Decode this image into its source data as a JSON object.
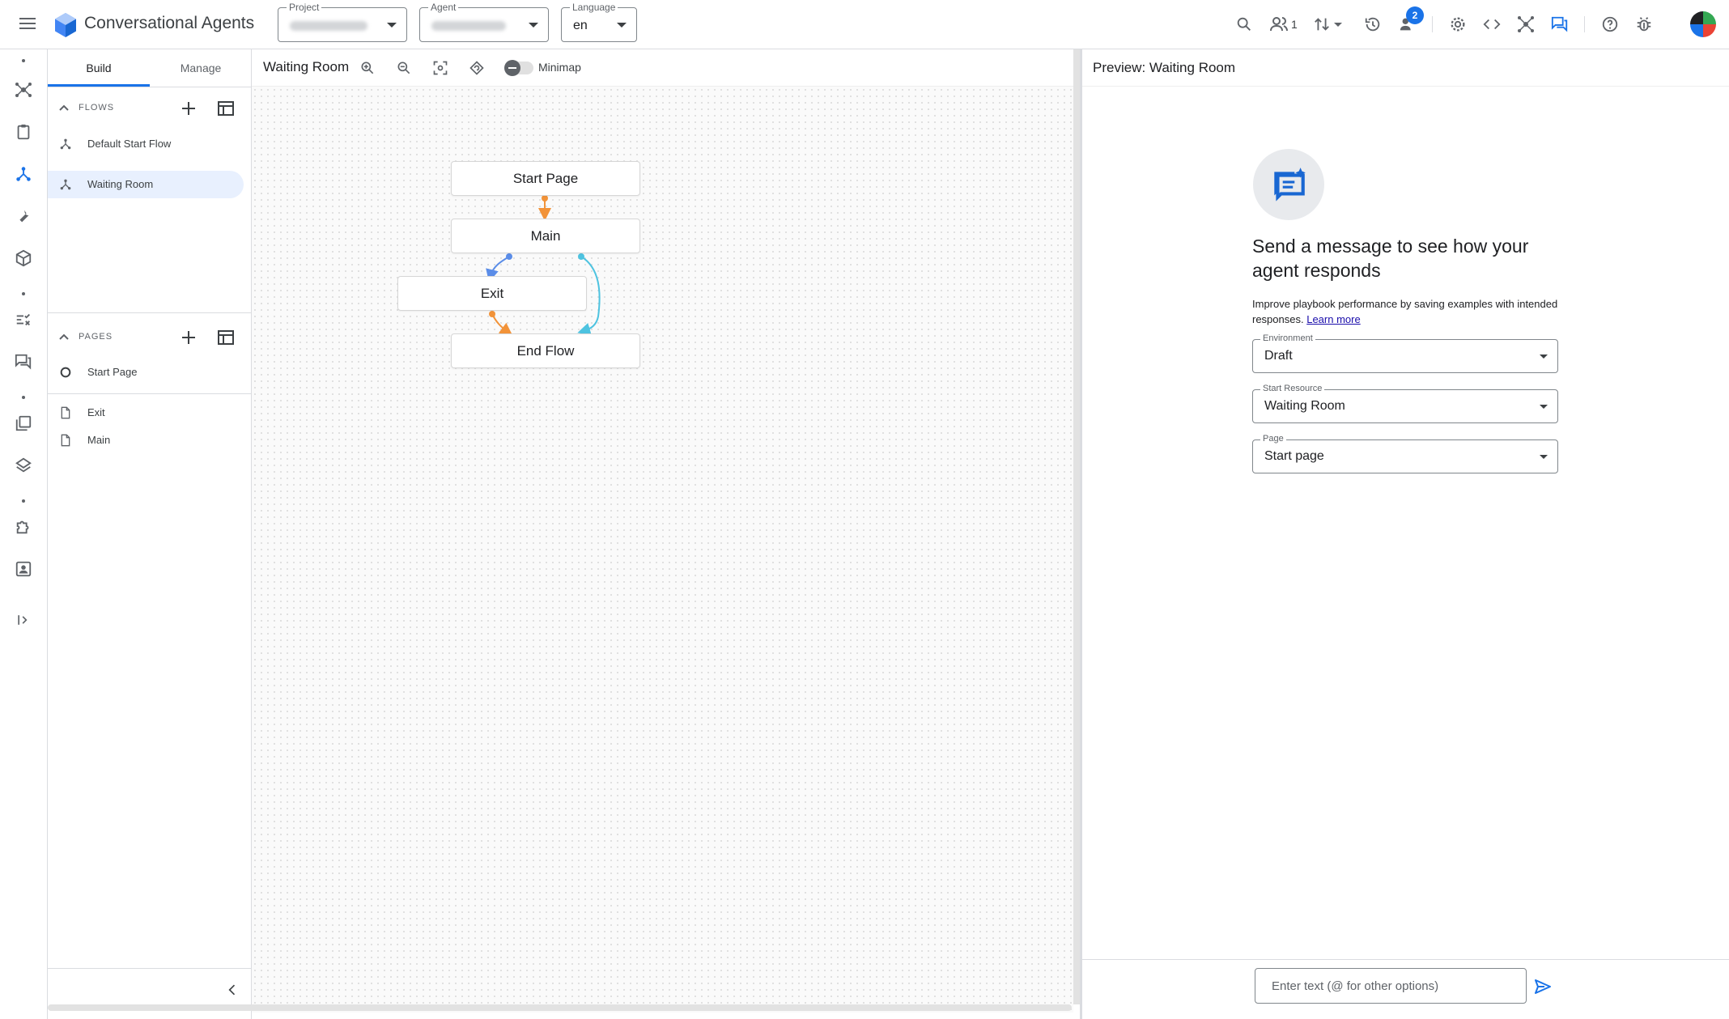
{
  "app": {
    "title": "Conversational Agents"
  },
  "selectors": {
    "project": {
      "label": "Project"
    },
    "agent": {
      "label": "Agent"
    },
    "language": {
      "label": "Language",
      "value": "en"
    }
  },
  "topbar": {
    "collaborators_count": "1",
    "notifications_badge": "2"
  },
  "left_panel": {
    "tabs": [
      {
        "label": "Build"
      },
      {
        "label": "Manage"
      }
    ],
    "flows": {
      "title": "FLOWS",
      "items": [
        {
          "label": "Default Start Flow"
        },
        {
          "label": "Waiting Room"
        }
      ]
    },
    "pages": {
      "title": "PAGES",
      "items": [
        {
          "label": "Start Page"
        },
        {
          "label": "Exit"
        },
        {
          "label": "Main"
        }
      ]
    }
  },
  "canvas": {
    "title": "Waiting Room",
    "minimap_label": "Minimap",
    "nodes": [
      {
        "label": "Start Page"
      },
      {
        "label": "Main"
      },
      {
        "label": "Exit"
      },
      {
        "label": "End Flow"
      }
    ],
    "colors": {
      "orange_edge": "#f29339",
      "blue_edge": "#5b8de8",
      "cyan_edge": "#4ec3e0"
    }
  },
  "preview": {
    "title": "Preview: Waiting Room",
    "heading": "Send a message to see how your agent responds",
    "description": "Improve playbook performance by saving examples with intended responses.",
    "learn_more": "Learn more",
    "fields": {
      "environment": {
        "label": "Environment",
        "value": "Draft"
      },
      "start_resource": {
        "label": "Start Resource",
        "value": "Waiting Room"
      },
      "page": {
        "label": "Page",
        "value": "Start page"
      }
    },
    "input_placeholder": "Enter text (@ for other options)"
  },
  "theme": {
    "accent": "#1a73e8",
    "selected_bg": "#e8f0fe"
  }
}
